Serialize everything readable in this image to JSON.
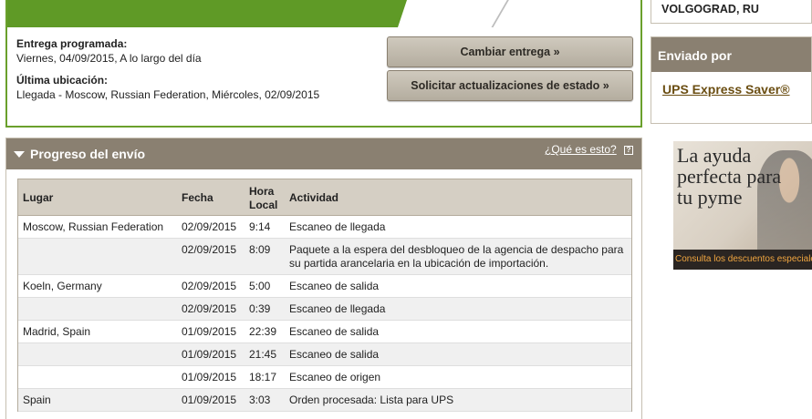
{
  "status": {
    "scheduled_label": "Entrega programada:",
    "scheduled_value": "Viernes, 04/09/2015, A lo largo del día",
    "last_location_label": "Última ubicación:",
    "last_location_value": "Llegada - Moscow, Russian Federation, Miércoles, 02/09/2015",
    "change_delivery_button": "Cambiar entrega »",
    "request_updates_button": "Solicitar actualizaciones de estado »",
    "accent_color": "#5f9a26"
  },
  "progress": {
    "title": "Progreso del envío",
    "whatis_link": "¿Qué es esto?",
    "help_icon": "?",
    "columns": {
      "location": "Lugar",
      "date": "Fecha",
      "time_line1": "Hora",
      "time_line2": "Local",
      "activity": "Actividad"
    },
    "rows": [
      {
        "location": "Moscow, Russian Federation",
        "date": "02/09/2015",
        "time": "9:14",
        "activity": "Escaneo de llegada"
      },
      {
        "location": "",
        "date": "02/09/2015",
        "time": "8:09",
        "activity": "Paquete a la espera del desbloqueo de la agencia de despacho para su partida arancelaria en la ubicación de importación."
      },
      {
        "location": "Koeln, Germany",
        "date": "02/09/2015",
        "time": "5:00",
        "activity": "Escaneo de salida"
      },
      {
        "location": "",
        "date": "02/09/2015",
        "time": "0:39",
        "activity": "Escaneo de llegada"
      },
      {
        "location": "Madrid, Spain",
        "date": "01/09/2015",
        "time": "22:39",
        "activity": "Escaneo de salida"
      },
      {
        "location": "",
        "date": "01/09/2015",
        "time": "21:45",
        "activity": "Escaneo de salida"
      },
      {
        "location": "",
        "date": "01/09/2015",
        "time": "18:17",
        "activity": "Escaneo de origen"
      },
      {
        "location": "Spain",
        "date": "01/09/2015",
        "time": "3:03",
        "activity": "Orden procesada: Lista para UPS"
      }
    ]
  },
  "sidebar": {
    "destination": "VOLGOGRAD, RU",
    "shipped_by_title": "Enviado por",
    "service_link": "UPS Express Saver®"
  },
  "ad": {
    "headline": "La ayuda perfecta para tu pyme",
    "footer": "Consulta los descuentos especiales"
  }
}
